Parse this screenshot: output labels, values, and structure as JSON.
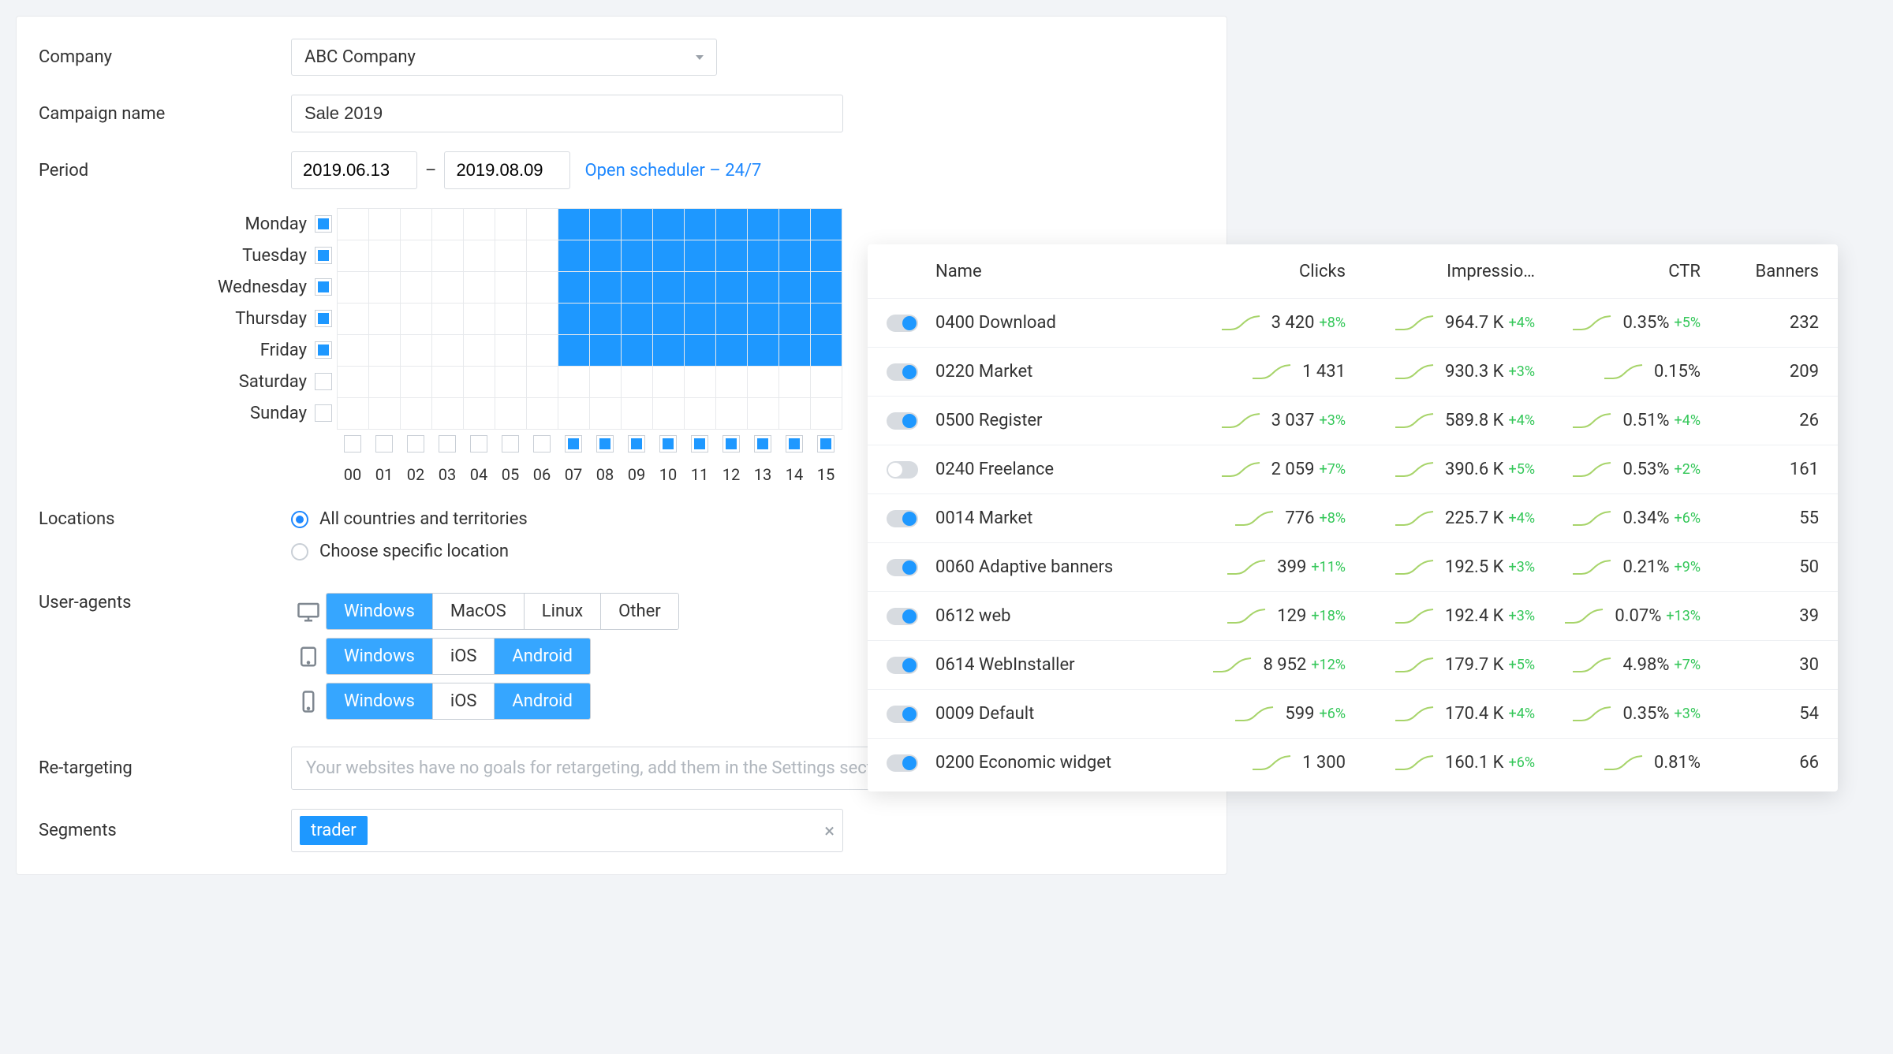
{
  "form": {
    "company_label": "Company",
    "company_value": "ABC Company",
    "campaign_label": "Campaign name",
    "campaign_value": "Sale 2019",
    "period_label": "Period",
    "period_from": "2019.06.13",
    "period_to": "2019.08.09",
    "scheduler_link": "Open scheduler – 24/7",
    "locations_label": "Locations",
    "locations_all": "All countries and territories",
    "locations_choose": "Choose specific location",
    "ua_label": "User-agents",
    "ua_desktop": [
      "Windows",
      "MacOS",
      "Linux",
      "Other"
    ],
    "ua_tablet": [
      "Windows",
      "iOS",
      "Android"
    ],
    "ua_mobile": [
      "Windows",
      "iOS",
      "Android"
    ],
    "ua_desktop_active": [
      true,
      false,
      false,
      false
    ],
    "ua_tablet_active": [
      true,
      false,
      true
    ],
    "ua_mobile_active": [
      true,
      false,
      true
    ],
    "retarget_label": "Re-targeting",
    "retarget_placeholder": "Your websites have no goals for retargeting, add them in the Settings section",
    "segments_label": "Segments",
    "segments_chip": "trader"
  },
  "scheduler": {
    "days": [
      "Monday",
      "Tuesday",
      "Wednesday",
      "Thursday",
      "Friday",
      "Saturday",
      "Sunday"
    ],
    "day_checked": [
      true,
      true,
      true,
      true,
      true,
      false,
      false
    ],
    "hours": [
      "00",
      "01",
      "02",
      "03",
      "04",
      "05",
      "06",
      "07",
      "08",
      "09",
      "10",
      "11",
      "12",
      "13",
      "14",
      "15"
    ],
    "hour_checked": [
      false,
      false,
      false,
      false,
      false,
      false,
      false,
      true,
      true,
      true,
      true,
      true,
      true,
      true,
      true,
      true
    ],
    "cells_on_cols": [
      7,
      8,
      9,
      10,
      11,
      12,
      13,
      14,
      15,
      16,
      17,
      18,
      19,
      20
    ],
    "cells_max_col": 15,
    "cells_on_rows": [
      0,
      1,
      2,
      3,
      4
    ]
  },
  "table": {
    "headers": {
      "name": "Name",
      "clicks": "Clicks",
      "impressions": "Impressio…",
      "ctr": "CTR",
      "banners": "Banners"
    },
    "rows": [
      {
        "on": true,
        "name": "0400 Download",
        "clicks": "3 420",
        "clicks_d": "+8%",
        "impr": "964.7 K",
        "impr_d": "+4%",
        "ctr": "0.35%",
        "ctr_d": "+5%",
        "banners": "232"
      },
      {
        "on": true,
        "name": "0220 Market",
        "clicks": "1 431",
        "clicks_d": "",
        "impr": "930.3 K",
        "impr_d": "+3%",
        "ctr": "0.15%",
        "ctr_d": "",
        "banners": "209"
      },
      {
        "on": true,
        "name": "0500 Register",
        "clicks": "3 037",
        "clicks_d": "+3%",
        "impr": "589.8 K",
        "impr_d": "+4%",
        "ctr": "0.51%",
        "ctr_d": "+4%",
        "banners": "26"
      },
      {
        "on": false,
        "name": "0240 Freelance",
        "clicks": "2 059",
        "clicks_d": "+7%",
        "impr": "390.6 K",
        "impr_d": "+5%",
        "ctr": "0.53%",
        "ctr_d": "+2%",
        "banners": "161"
      },
      {
        "on": true,
        "name": "0014 Market",
        "clicks": "776",
        "clicks_d": "+8%",
        "impr": "225.7 K",
        "impr_d": "+4%",
        "ctr": "0.34%",
        "ctr_d": "+6%",
        "banners": "55"
      },
      {
        "on": true,
        "name": "0060 Adaptive banners",
        "clicks": "399",
        "clicks_d": "+11%",
        "impr": "192.5 K",
        "impr_d": "+3%",
        "ctr": "0.21%",
        "ctr_d": "+9%",
        "banners": "50"
      },
      {
        "on": true,
        "name": "0612 web",
        "clicks": "129",
        "clicks_d": "+18%",
        "impr": "192.4 K",
        "impr_d": "+3%",
        "ctr": "0.07%",
        "ctr_d": "+13%",
        "banners": "39"
      },
      {
        "on": true,
        "name": "0614 WebInstaller",
        "clicks": "8 952",
        "clicks_d": "+12%",
        "impr": "179.7 K",
        "impr_d": "+5%",
        "ctr": "4.98%",
        "ctr_d": "+7%",
        "banners": "30"
      },
      {
        "on": true,
        "name": "0009 Default",
        "clicks": "599",
        "clicks_d": "+6%",
        "impr": "170.4 K",
        "impr_d": "+4%",
        "ctr": "0.35%",
        "ctr_d": "+3%",
        "banners": "54"
      },
      {
        "on": true,
        "name": "0200 Economic widget",
        "clicks": "1 300",
        "clicks_d": "",
        "impr": "160.1 K",
        "impr_d": "+6%",
        "ctr": "0.81%",
        "ctr_d": "",
        "banners": "66"
      }
    ]
  }
}
